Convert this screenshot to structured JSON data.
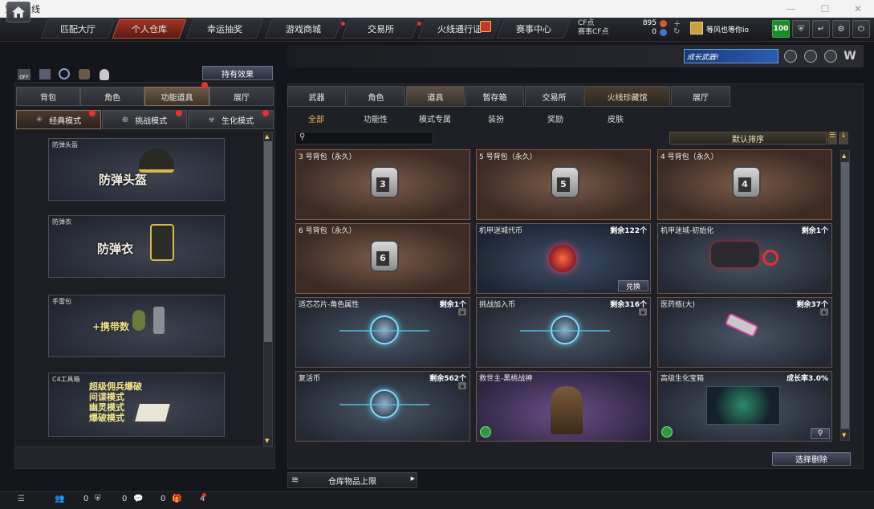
{
  "window": {
    "title": "穿越火线"
  },
  "nav": {
    "tabs": [
      "匹配大厅",
      "个人仓库",
      "幸运抽奖",
      "游戏商城",
      "交易所",
      "火线通行证",
      "赛事中心"
    ],
    "active": "个人仓库"
  },
  "currency": {
    "cf_label": "CF点",
    "cf_value": "895",
    "match_label": "赛事CF点",
    "match_value": "0"
  },
  "user": {
    "name": "等风也等你io",
    "level": "100"
  },
  "banner": {
    "text": "成长武器!"
  },
  "left": {
    "effect_button": "持有效果",
    "tabs": [
      "背包",
      "角色",
      "功能道具",
      "展厅"
    ],
    "active_tab": "功能道具",
    "mode_tabs": [
      "经典模式",
      "挑战模式",
      "生化模式"
    ],
    "cards": [
      {
        "caption": "防弹头盔",
        "title": "防弹头盔"
      },
      {
        "caption": "防弹衣",
        "title": "防弹衣"
      },
      {
        "caption": "手雷包",
        "title": "+携带数"
      },
      {
        "caption": "C4工具箱",
        "lines": [
          "超级佣兵爆破",
          "间谍模式",
          "幽灵模式",
          "爆破模式"
        ]
      }
    ]
  },
  "right": {
    "tabs": [
      "武器",
      "角色",
      "道具",
      "暂存箱",
      "交易所",
      "火线珍藏馆",
      "展厅"
    ],
    "active_tab": "道具",
    "subtabs": [
      "全部",
      "功能性",
      "模式专属",
      "装扮",
      "奖励",
      "皮肤"
    ],
    "active_subtab": "全部",
    "sort_label": "默认排序",
    "items": [
      {
        "name": "3 号背包（永久）",
        "qty": "",
        "style": "brown",
        "icon": "bag-3",
        "bagnum": "3"
      },
      {
        "name": "5 号背包（永久）",
        "qty": "",
        "style": "brown",
        "icon": "bag-5",
        "bagnum": "5"
      },
      {
        "name": "4 号背包（永久）",
        "qty": "",
        "style": "brown",
        "icon": "bag-4",
        "bagnum": "4"
      },
      {
        "name": "6 号背包（永久）",
        "qty": "",
        "style": "brown",
        "icon": "bag-6",
        "bagnum": "6"
      },
      {
        "name": "机甲迷城代币",
        "qty": "剩余122个",
        "style": "blue",
        "icon": "token",
        "action": "兑换"
      },
      {
        "name": "机甲迷城-初始化",
        "qty": "剩余1个",
        "style": "gblue",
        "icon": "mech"
      },
      {
        "name": "适芯芯片-角色属性",
        "qty": "剩余1个",
        "style": "gblue",
        "icon": "chip"
      },
      {
        "name": "挑战加入币",
        "qty": "剩余316个",
        "style": "gblue",
        "icon": "coin"
      },
      {
        "name": "医药瓶(大)",
        "qty": "剩余37个",
        "style": "gblue",
        "icon": "medkit"
      },
      {
        "name": "复活币",
        "qty": "剩余562个",
        "style": "gblue",
        "icon": "revive"
      },
      {
        "name": "救世主-黑桃战神",
        "qty": "",
        "style": "purple",
        "icon": "soldier"
      },
      {
        "name": "高级生化宝箱",
        "qty": "成长率3.0%",
        "style": "gblue",
        "icon": "chest"
      }
    ],
    "delete_button": "选择删除",
    "storage_label": "仓库物品上限"
  },
  "bottom": {
    "v1": "0",
    "v2": "0",
    "v3": "0",
    "v4": "4"
  }
}
